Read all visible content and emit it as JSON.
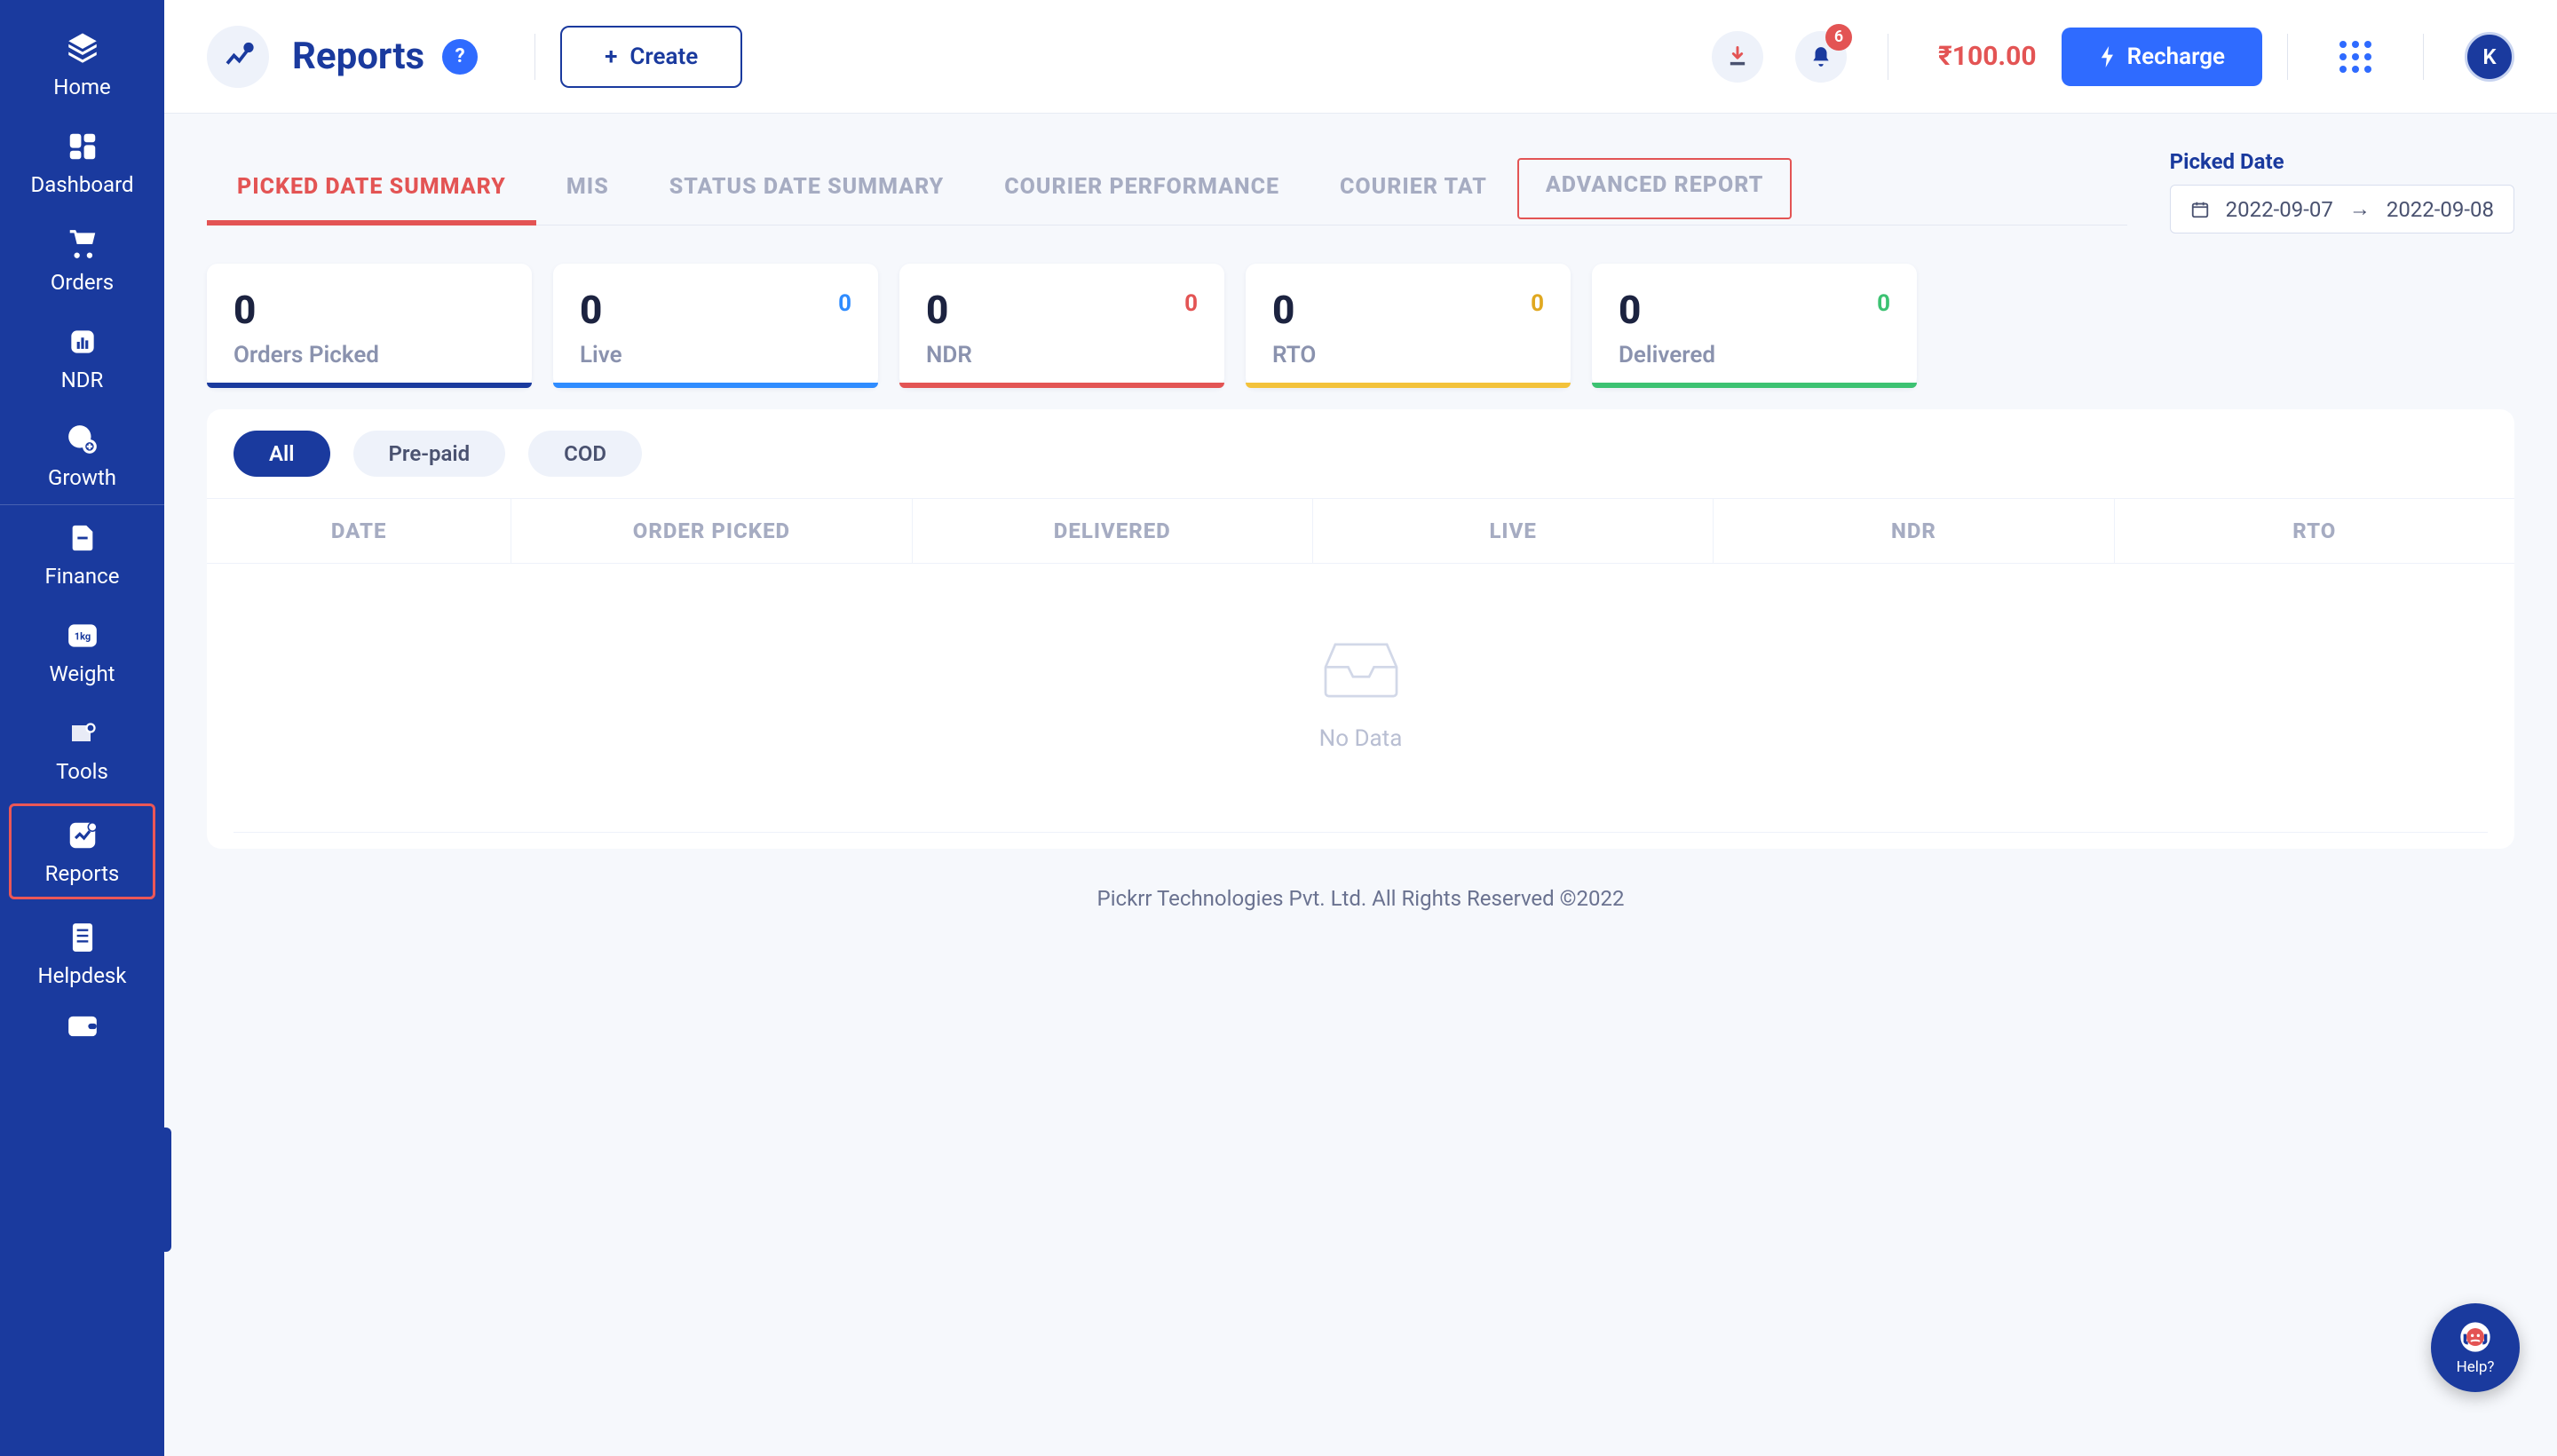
{
  "sidebar": {
    "items": [
      {
        "label": "Home"
      },
      {
        "label": "Dashboard"
      },
      {
        "label": "Orders"
      },
      {
        "label": "NDR"
      },
      {
        "label": "Growth"
      },
      {
        "label": "Finance"
      },
      {
        "label": "Weight"
      },
      {
        "label": "Tools"
      },
      {
        "label": "Reports"
      },
      {
        "label": "Helpdesk"
      }
    ]
  },
  "header": {
    "title": "Reports",
    "help": "?",
    "create": "Create",
    "notif_count": "6",
    "balance": "₹100.00",
    "recharge": "Recharge",
    "avatar": "K"
  },
  "tabs": {
    "items": [
      {
        "label": "PICKED DATE SUMMARY"
      },
      {
        "label": "MIS"
      },
      {
        "label": "STATUS DATE SUMMARY"
      },
      {
        "label": "COURIER PERFORMANCE"
      },
      {
        "label": "COURIER TAT"
      },
      {
        "label": "ADVANCED REPORT"
      }
    ]
  },
  "date_picker": {
    "label": "Picked Date",
    "from": "2022-09-07",
    "to": "2022-09-08"
  },
  "stats": [
    {
      "value": "0",
      "label": "Orders Picked",
      "sub": ""
    },
    {
      "value": "0",
      "label": "Live",
      "sub": "0"
    },
    {
      "value": "0",
      "label": "NDR",
      "sub": "0"
    },
    {
      "value": "0",
      "label": "RTO",
      "sub": "0"
    },
    {
      "value": "0",
      "label": "Delivered",
      "sub": "0"
    }
  ],
  "pills": [
    {
      "label": "All"
    },
    {
      "label": "Pre-paid"
    },
    {
      "label": "COD"
    }
  ],
  "table": {
    "columns": [
      "DATE",
      "ORDER PICKED",
      "DELIVERED",
      "LIVE",
      "NDR",
      "RTO"
    ],
    "empty": "No Data"
  },
  "footer": "Pickrr Technologies Pvt. Ltd. All Rights Reserved ©2022",
  "help_fab": "Help?"
}
